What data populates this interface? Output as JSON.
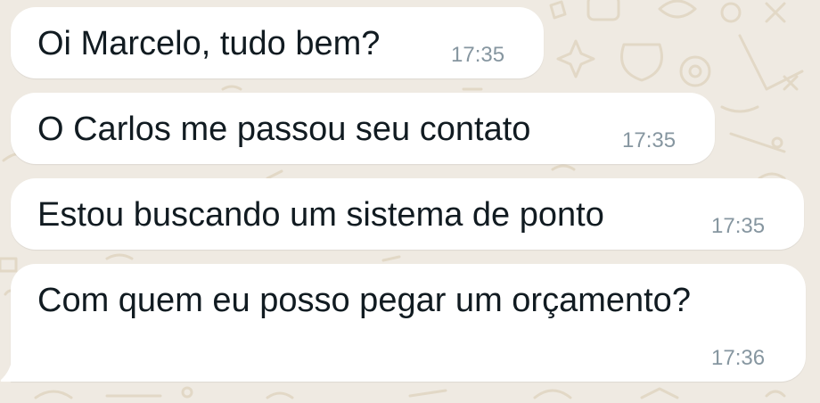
{
  "conversation": {
    "messages": [
      {
        "text": "Oi Marcelo, tudo bem?",
        "time": "17:35"
      },
      {
        "text": "O Carlos me passou seu contato",
        "time": "17:35"
      },
      {
        "text": "Estou buscando um sistema de ponto",
        "time": "17:35"
      },
      {
        "text": "Com quem eu posso pegar um orçamento?",
        "time": "17:36"
      }
    ]
  },
  "colors": {
    "background": "#efeae2",
    "bubble": "#ffffff",
    "message_text": "#111b21",
    "timestamp": "#8696a0"
  }
}
